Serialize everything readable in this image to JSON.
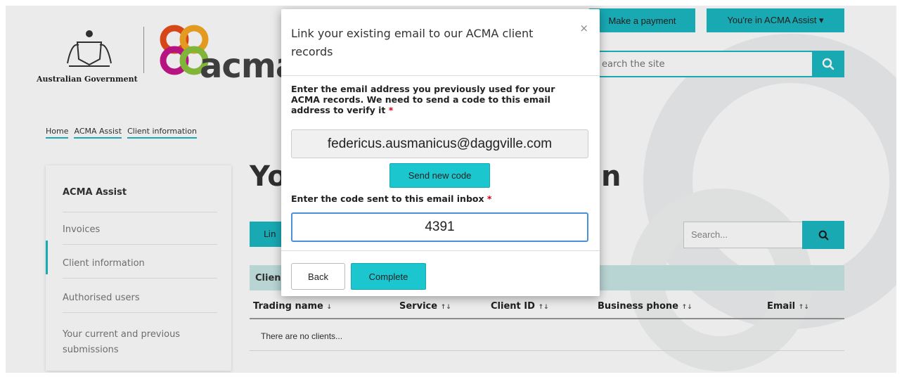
{
  "header": {
    "gov_label": "Australian Government",
    "brand": "acma",
    "make_payment": "Make a payment",
    "account_menu": "You're in ACMA Assist ▾",
    "search_placeholder": "earch the site"
  },
  "breadcrumb": [
    "Home",
    "ACMA Assist",
    "Client information"
  ],
  "sidebar": {
    "title": "ACMA Assist",
    "items": [
      "Invoices",
      "Client information",
      "Authorised users",
      "Your current and previous submissions"
    ]
  },
  "main": {
    "heading_left": "Yo",
    "heading_right": "n",
    "link_button": "Lin",
    "table_search_placeholder": "Search...",
    "table_caption": "Clien",
    "columns": [
      {
        "label": "Trading name",
        "sort": "↓"
      },
      {
        "label": "Service",
        "sort": "↑↓"
      },
      {
        "label": "Client ID",
        "sort": "↑↓"
      },
      {
        "label": "Business phone",
        "sort": "↑↓"
      },
      {
        "label": "Email",
        "sort": "↑↓"
      }
    ],
    "empty_message": "There are no clients..."
  },
  "modal": {
    "title": "Link your existing email to our ACMA client records",
    "close": "×",
    "email_description": "Enter the email address you previously used for your ACMA records. We need to send a code to this email address to verify it",
    "required_marker": "*",
    "email_value": "federicus.ausmanicus@daggville.com",
    "send_code": "Send new code",
    "code_label": "Enter the code sent to this email inbox",
    "code_value": "4391",
    "back": "Back",
    "complete": "Complete"
  },
  "colors": {
    "accent": "#1bb8c3",
    "required": "#d0021b",
    "focus_border": "#4a90d9"
  }
}
